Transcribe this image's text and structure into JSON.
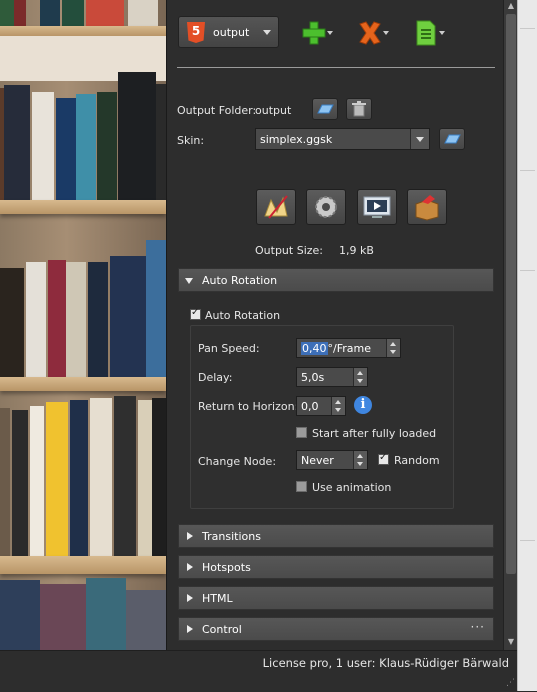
{
  "toolbar": {
    "format_label": "output",
    "format_icon": "html5-icon",
    "add_icon": "add-output-icon",
    "remove_icon": "remove-output-icon",
    "document_icon": "document-icon"
  },
  "output_folder": {
    "label": "Output Folder:",
    "value": "output"
  },
  "skin": {
    "label": "Skin:",
    "value": "simplex.ggsk"
  },
  "output_size": {
    "label": "Output Size:",
    "value": "1,9 kB"
  },
  "auto_rotation": {
    "section_title": "Auto Rotation",
    "enabled_label": "Auto Rotation",
    "enabled": true,
    "pan_speed": {
      "label": "Pan Speed:",
      "value": "0,40",
      "unit": "°/Frame"
    },
    "delay": {
      "label": "Delay:",
      "value": "5,0s"
    },
    "return_to_horizon": {
      "label": "Return to Horizon:",
      "value": "0,0"
    },
    "start_after_loaded": {
      "label": "Start after fully loaded",
      "checked": false
    },
    "change_node": {
      "label": "Change Node:",
      "value": "Never"
    },
    "random": {
      "label": "Random",
      "checked": true
    },
    "use_animation": {
      "label": "Use animation",
      "checked": false
    }
  },
  "sections": [
    {
      "title": "Transitions"
    },
    {
      "title": "Hotspots"
    },
    {
      "title": "HTML"
    },
    {
      "title": "Control",
      "more": "···"
    }
  ],
  "status": {
    "text": "License pro, 1 user: Klaus-Rüdiger Bärwald"
  },
  "colors": {
    "panel": "#2d2d2d",
    "section": "#505050",
    "accent": "#3f86e0"
  }
}
